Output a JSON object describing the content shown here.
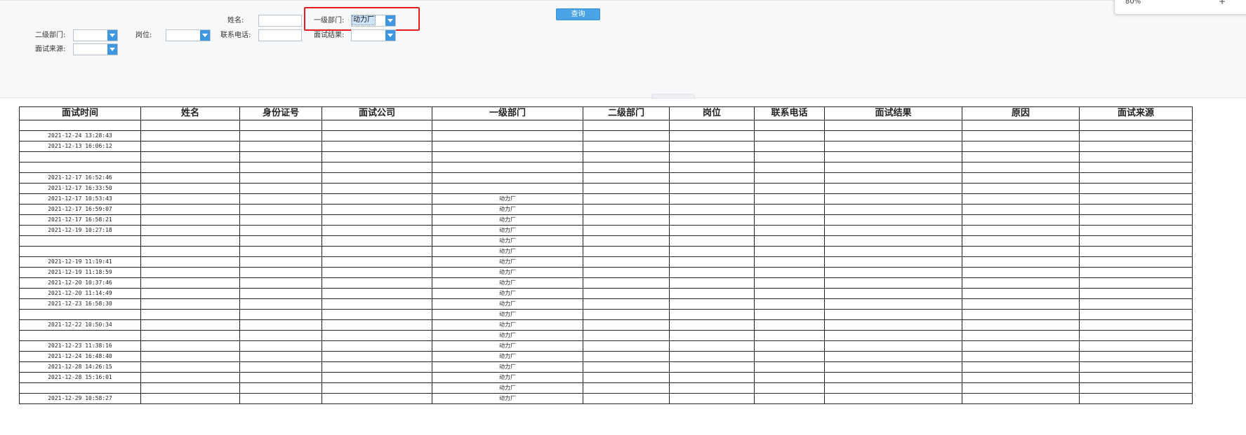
{
  "filters": {
    "name_label": "姓名:",
    "dept1_label": "一级部门:",
    "dept1_value": "动力厂",
    "dept2_label": "二级部门:",
    "position_label": "岗位:",
    "phone_label": "联系电话:",
    "result_label": "面试结果:",
    "source_label": "面试来源:",
    "query_button": "查询"
  },
  "zoom_popup": {
    "zoom": "80%",
    "plus": "+"
  },
  "colors": {
    "accent": "#4aa3e6",
    "highlight": "#e02020",
    "selection": "#cfe4fb"
  },
  "table": {
    "columns": [
      "面试时间",
      "姓名",
      "身份证号",
      "面试公司",
      "一级部门",
      "二级部门",
      "岗位",
      "联系电话",
      "面试结果",
      "原因",
      "面试来源"
    ],
    "rows": [
      [
        "",
        "",
        "",
        "",
        "",
        "",
        "",
        "",
        "",
        "",
        ""
      ],
      [
        "2021-12-24 13:28:43",
        "",
        "",
        "",
        "",
        "",
        "",
        "",
        "",
        "",
        ""
      ],
      [
        "2021-12-13 16:06:12",
        "",
        "",
        "",
        "",
        "",
        "",
        "",
        "",
        "",
        ""
      ],
      [
        "",
        "",
        "",
        "",
        "",
        "",
        "",
        "",
        "",
        "",
        ""
      ],
      [
        "",
        "",
        "",
        "",
        "",
        "",
        "",
        "",
        "",
        "",
        ""
      ],
      [
        "2021-12-17 16:52:46",
        "",
        "",
        "",
        "",
        "",
        "",
        "",
        "",
        "",
        ""
      ],
      [
        "2021-12-17 16:33:50",
        "",
        "",
        "",
        "",
        "",
        "",
        "",
        "",
        "",
        ""
      ],
      [
        "2021-12-17 10:53:43",
        "",
        "",
        "",
        "动力厂",
        "",
        "",
        "",
        "",
        "",
        ""
      ],
      [
        "2021-12-17 16:59:07",
        "",
        "",
        "",
        "动力厂",
        "",
        "",
        "",
        "",
        "",
        ""
      ],
      [
        "2021-12-17 16:58:21",
        "",
        "",
        "",
        "动力厂",
        "",
        "",
        "",
        "",
        "",
        ""
      ],
      [
        "2021-12-19 10:27:18",
        "",
        "",
        "",
        "动力厂",
        "",
        "",
        "",
        "",
        "",
        ""
      ],
      [
        "",
        "",
        "",
        "",
        "动力厂",
        "",
        "",
        "",
        "",
        "",
        ""
      ],
      [
        "",
        "",
        "",
        "",
        "动力厂",
        "",
        "",
        "",
        "",
        "",
        ""
      ],
      [
        "2021-12-19 11:19:41",
        "",
        "",
        "",
        "动力厂",
        "",
        "",
        "",
        "",
        "",
        ""
      ],
      [
        "2021-12-19 11:18:59",
        "",
        "",
        "",
        "动力厂",
        "",
        "",
        "",
        "",
        "",
        ""
      ],
      [
        "2021-12-20 10:37:46",
        "",
        "",
        "",
        "动力厂",
        "",
        "",
        "",
        "",
        "",
        ""
      ],
      [
        "2021-12-20 11:14:49",
        "",
        "",
        "",
        "动力厂",
        "",
        "",
        "",
        "",
        "",
        ""
      ],
      [
        "2021-12-23 16:58:30",
        "",
        "",
        "",
        "动力厂",
        "",
        "",
        "",
        "",
        "",
        ""
      ],
      [
        "",
        "",
        "",
        "",
        "动力厂",
        "",
        "",
        "",
        "",
        "",
        ""
      ],
      [
        "2021-12-22 10:50:34",
        "",
        "",
        "",
        "动力厂",
        "",
        "",
        "",
        "",
        "",
        ""
      ],
      [
        "",
        "",
        "",
        "",
        "动力厂",
        "",
        "",
        "",
        "",
        "",
        ""
      ],
      [
        "2021-12-23 11:38:16",
        "",
        "",
        "",
        "动力厂",
        "",
        "",
        "",
        "",
        "",
        ""
      ],
      [
        "2021-12-24 16:48:40",
        "",
        "",
        "",
        "动力厂",
        "",
        "",
        "",
        "",
        "",
        ""
      ],
      [
        "2021-12-28 14:26:15",
        "",
        "",
        "",
        "动力厂",
        "",
        "",
        "",
        "",
        "",
        ""
      ],
      [
        "2021-12-28 15:16:01",
        "",
        "",
        "",
        "动力厂",
        "",
        "",
        "",
        "",
        "",
        ""
      ],
      [
        "",
        "",
        "",
        "",
        "动力厂",
        "",
        "",
        "",
        "",
        "",
        ""
      ],
      [
        "2021-12-29 10:58:27",
        "",
        "",
        "",
        "动力厂",
        "",
        "",
        "",
        "",
        "",
        ""
      ]
    ]
  }
}
